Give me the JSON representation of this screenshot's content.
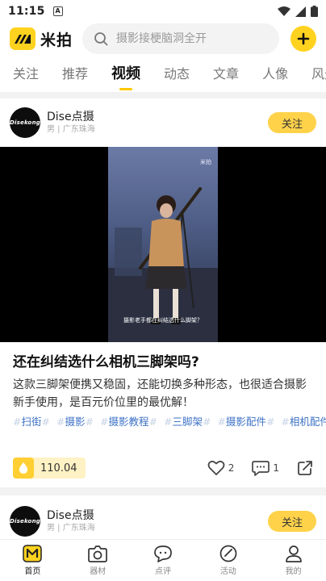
{
  "status_bar": {
    "time": "11:15",
    "notification_icon": "a-icon"
  },
  "header": {
    "logo_text": "米拍",
    "search": {
      "placeholder": "摄影接梗脑洞全开"
    },
    "add_icon": "plus-icon"
  },
  "tabs": [
    {
      "label": "关注",
      "active": false
    },
    {
      "label": "推荐",
      "active": false
    },
    {
      "label": "视频",
      "active": true
    },
    {
      "label": "动态",
      "active": false
    },
    {
      "label": "文章",
      "active": false
    },
    {
      "label": "人像",
      "active": false
    },
    {
      "label": "风光",
      "active": false
    }
  ],
  "posts": [
    {
      "avatar_text": "Disekong",
      "author": "Dise点摄",
      "meta": "男 | 广东珠海",
      "follow_label": "关注",
      "video": {
        "watermark": "米拍",
        "caption": "摄影老手都在纠结选什么脚架？"
      },
      "title": "还在纠结选什么相机三脚架吗?",
      "description": "这款三脚架便携又稳固，还能切换多种形态，也很适合摄影新手使用，是百元价位里的最优解！",
      "tags": [
        "扫街",
        "摄影",
        "摄影教程",
        "三脚架",
        "摄影配件",
        "相机配件"
      ],
      "coin_value": "110.04",
      "likes": "2",
      "comments": "1"
    },
    {
      "avatar_text": "Disekong",
      "author": "Dise点摄",
      "meta": "男 | 广东珠海",
      "follow_label": "关注"
    }
  ],
  "bottom_nav": [
    {
      "label": "首页",
      "icon": "home-icon",
      "active": true
    },
    {
      "label": "器材",
      "icon": "camera-icon",
      "active": false
    },
    {
      "label": "点评",
      "icon": "review-icon",
      "active": false
    },
    {
      "label": "活动",
      "icon": "activity-icon",
      "active": false
    },
    {
      "label": "我的",
      "icon": "profile-icon",
      "active": false
    }
  ],
  "colors": {
    "accent": "#ffd21f",
    "tag": "#3d72c6"
  }
}
